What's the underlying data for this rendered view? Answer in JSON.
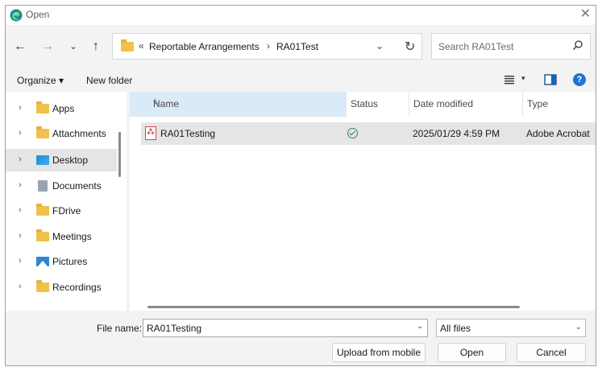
{
  "window": {
    "title": "Open",
    "close_glyph": "✕"
  },
  "nav": {
    "back_glyph": "←",
    "forward_glyph": "→",
    "recent_glyph": "⌄",
    "up_glyph": "↑"
  },
  "address": {
    "overflow_glyph": "«",
    "crumbs": [
      "Reportable Arrangements",
      "RA01Test"
    ],
    "separator_glyph": "›",
    "dropdown_glyph": "⌄",
    "refresh_glyph": "↻"
  },
  "search": {
    "placeholder": "Search RA01Test"
  },
  "toolbar": {
    "organize_label": "Organize ▾",
    "new_folder_label": "New folder",
    "view_dropdown_glyph": "▾",
    "help_glyph": "?"
  },
  "sidebar": {
    "items": [
      {
        "label": "Apps",
        "icon": "folder-icon",
        "selected": false
      },
      {
        "label": "Attachments",
        "icon": "folder-icon",
        "selected": false
      },
      {
        "label": "Desktop",
        "icon": "desktop-icon",
        "selected": true
      },
      {
        "label": "Documents",
        "icon": "documents-icon",
        "selected": false
      },
      {
        "label": "FDrive",
        "icon": "folder-icon",
        "selected": false
      },
      {
        "label": "Meetings",
        "icon": "folder-icon",
        "selected": false
      },
      {
        "label": "Pictures",
        "icon": "pictures-icon",
        "selected": false
      },
      {
        "label": "Recordings",
        "icon": "folder-icon",
        "selected": false
      }
    ],
    "chevron_glyph": "›"
  },
  "columns": {
    "name": "Name",
    "status": "Status",
    "date_modified": "Date modified",
    "type": "Type",
    "sort_glyph": "^",
    "name_dropdown_glyph": "⌄"
  },
  "files": [
    {
      "name": "RA01Testing",
      "icon": "pdf-icon",
      "status_icon": "synced-check-icon",
      "date_modified": "2025/01/29 4:59 PM",
      "type": "Adobe Acrobat"
    }
  ],
  "bottom": {
    "file_name_label": "File name:",
    "file_name_value": "RA01Testing",
    "file_name_dropdown_glyph": "⌄",
    "filter_value": "All files",
    "filter_dropdown_glyph": "⌄",
    "upload_label": "Upload from mobile",
    "open_label": "Open",
    "cancel_label": "Cancel"
  },
  "colors": {
    "accent": "#1e74d6",
    "selection": "#e5e5e5",
    "header_highlight": "#dbeaf7",
    "pdf_red": "#c42b1c",
    "folder_yellow": "#f0c14b",
    "status_green": "#2e8b57"
  }
}
